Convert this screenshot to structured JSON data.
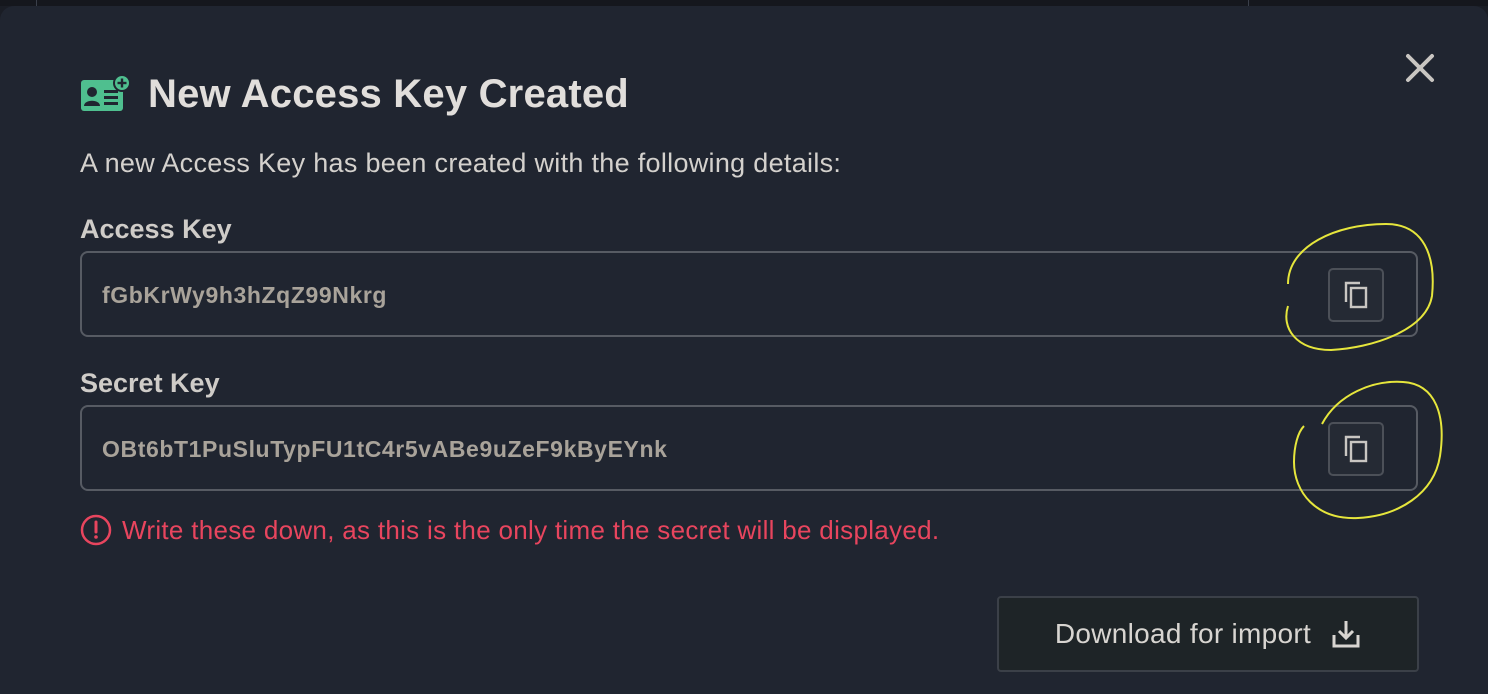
{
  "dialog": {
    "title": "New Access Key Created",
    "description": "A new Access Key has been created with the following details:",
    "access_key": {
      "label": "Access Key",
      "value": "fGbKrWy9h3hZqZ99Nkrg"
    },
    "secret_key": {
      "label": "Secret Key",
      "value": "OBt6bT1PuSluTypFU1tC4r5vABe9uZeF9kByEYnk"
    },
    "warning": "Write these down, as this is the only time the secret will be displayed.",
    "download_button_label": "Download for import"
  },
  "icons": {
    "title": "add-user-card-icon",
    "close": "close-icon",
    "copy": "copy-icon",
    "warning": "alert-circle-icon",
    "download": "download-icon"
  },
  "colors": {
    "modal_background": "#202530",
    "title_icon": "#4fbf8f",
    "warning": "#e8455e",
    "annotation": "#e6e63c"
  }
}
